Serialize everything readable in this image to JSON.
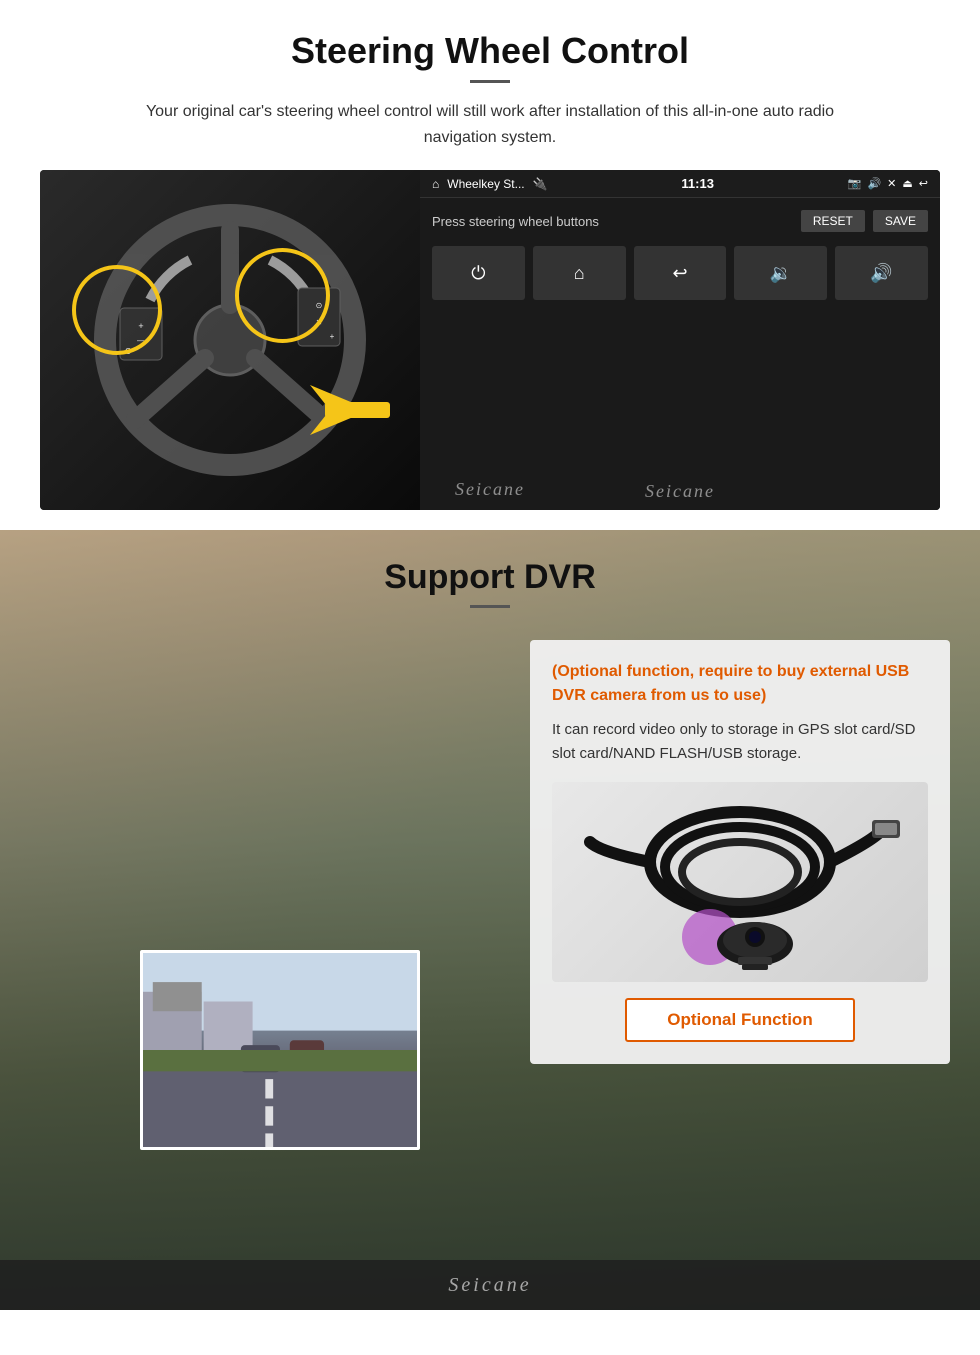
{
  "steering": {
    "title": "Steering Wheel Control",
    "description": "Your original car's steering wheel control will still work after installation of this all-in-one auto radio navigation system.",
    "statusbar": {
      "app_name": "Wheelkey St...",
      "time": "11:13",
      "nav_icons": [
        "🏠",
        "📷",
        "🔊",
        "✕",
        "⏏",
        "↩"
      ]
    },
    "swc_label": "Press steering wheel buttons",
    "reset_btn": "RESET",
    "save_btn": "SAVE",
    "grid_icons": [
      "⏻",
      "⌂",
      "↩",
      "🔊+",
      "🔊+"
    ],
    "watermark": "Seicane"
  },
  "dvr": {
    "title": "Support DVR",
    "optional_text": "(Optional function, require to buy external USB DVR camera from us to use)",
    "description": "It can record video only to storage in GPS slot card/SD slot card/NAND FLASH/USB storage.",
    "optional_function_label": "Optional Function",
    "watermark": "Seicane"
  }
}
